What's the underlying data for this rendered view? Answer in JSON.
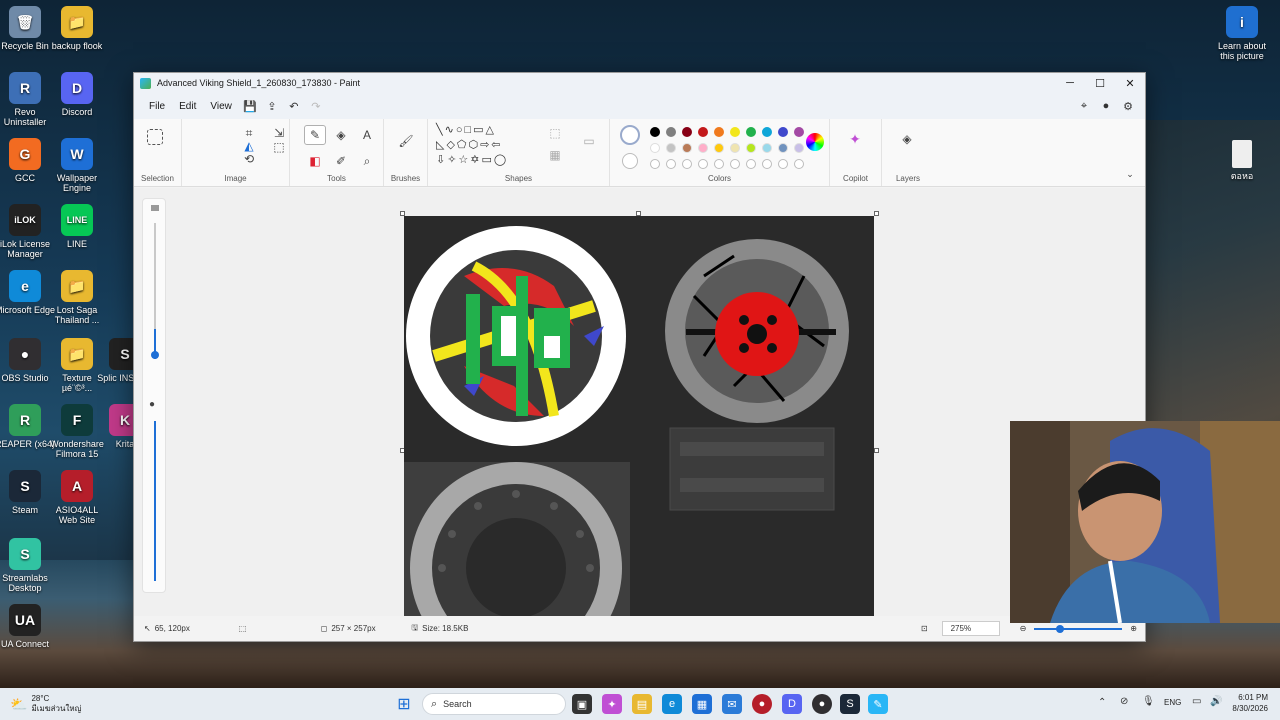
{
  "desktop": {
    "icons": [
      {
        "label": "Recycle Bin",
        "glyph": "🗑",
        "color": "#6f8aa8"
      },
      {
        "label": "backup flook",
        "glyph": "📁",
        "color": "#e8b830"
      },
      {
        "label": "Revo Uninstaller",
        "glyph": "R",
        "color": "#3d6fb6"
      },
      {
        "label": "Discord",
        "glyph": "D",
        "color": "#5865f2"
      },
      {
        "label": "GCC",
        "glyph": "G",
        "color": "#f26b21"
      },
      {
        "label": "Wallpaper Engine",
        "glyph": "W",
        "color": "#1e6fd6"
      },
      {
        "label": "iLok License Manager",
        "glyph": "iLOK",
        "color": "#222222"
      },
      {
        "label": "LINE",
        "glyph": "LINE",
        "color": "#06c755"
      },
      {
        "label": "Microsoft Edge",
        "glyph": "e",
        "color": "#0f8ad8"
      },
      {
        "label": "Lost Saga Thailand ...",
        "glyph": "📁",
        "color": "#e8b830"
      },
      {
        "label": "OBS Studio",
        "glyph": "●",
        "color": "#302e31"
      },
      {
        "label": "Texture µé¨©³...",
        "glyph": "📁",
        "color": "#e8b830"
      },
      {
        "label": "Splic INSTRU",
        "glyph": "S",
        "color": "#222222"
      },
      {
        "label": "REAPER (x64)",
        "glyph": "R",
        "color": "#2f9e5a"
      },
      {
        "label": "Wondershare Filmora 15",
        "glyph": "F",
        "color": "#0e3b3b"
      },
      {
        "label": "Krita",
        "glyph": "K",
        "color": "#c23a8a"
      },
      {
        "label": "Steam",
        "glyph": "S",
        "color": "#1b2838"
      },
      {
        "label": "ASIO4ALL Web Site",
        "glyph": "A",
        "color": "#b51e2a"
      },
      {
        "label": "Streamlabs Desktop",
        "glyph": "S",
        "color": "#31c3a2"
      },
      {
        "label": "UA Connect",
        "glyph": "UA",
        "color": "#222222"
      }
    ],
    "learn_about": "Learn about this picture",
    "right_file": "ตอหอ"
  },
  "window": {
    "title": "Advanced Viking Shield_1_260830_173830 - Paint",
    "minimize": "─",
    "maximize": "☐",
    "close": "✕"
  },
  "menu": {
    "file": "File",
    "edit": "Edit",
    "view": "View"
  },
  "ribbon": {
    "selection": "Selection",
    "image": "Image",
    "tools": "Tools",
    "brushes": "Brushes",
    "shapes": "Shapes",
    "colors": "Colors",
    "copilot": "Copilot",
    "layers": "Layers",
    "palette_row1": [
      "#000000",
      "#7f7f7f",
      "#880015",
      "#c3191b",
      "#f07a1e",
      "#f2e61c",
      "#22b14c",
      "#0fa6d8",
      "#3f48cc",
      "#a349a4"
    ],
    "palette_row2": [
      "#ffffff",
      "#c3c3c3",
      "#b97a57",
      "#ffaec9",
      "#ffc90e",
      "#efe4b0",
      "#b5e61d",
      "#99d9ea",
      "#7092be",
      "#c8bfe7"
    ]
  },
  "status": {
    "cursor": "65, 120px",
    "selection_size": "257 × 257px",
    "file_size": "Size: 18.5KB",
    "zoom": "275%"
  },
  "taskbar": {
    "weather_temp": "28°C",
    "weather_text": "มีเมฆส่วนใหญ่",
    "search": "Search",
    "lang": "ENG",
    "time": "6:01 PM",
    "date": "8/30/2026"
  }
}
